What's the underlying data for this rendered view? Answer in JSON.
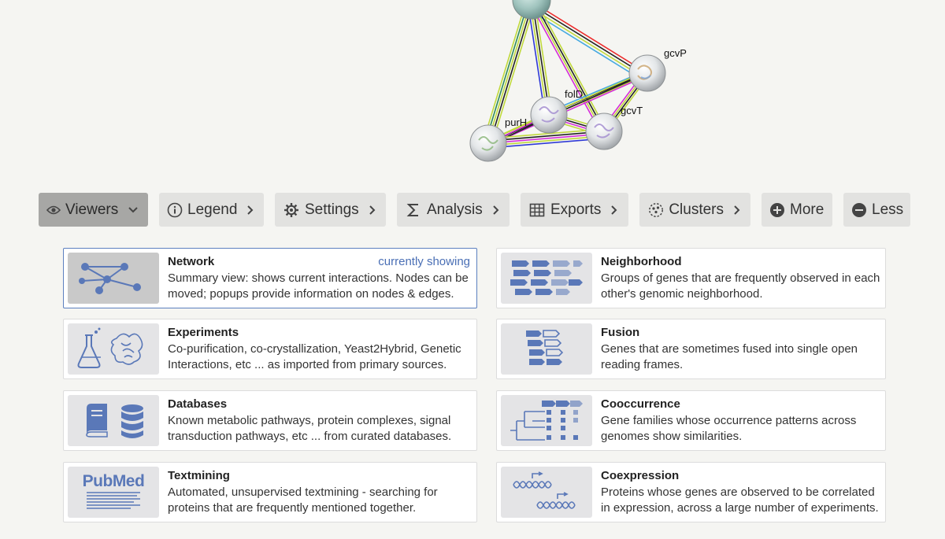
{
  "network": {
    "nodes": [
      {
        "label": "gcvP"
      },
      {
        "label": "folD"
      },
      {
        "label": "gcvT"
      },
      {
        "label": "purH"
      }
    ]
  },
  "toolbar": {
    "viewers": "Viewers",
    "legend": "Legend",
    "settings": "Settings",
    "analysis": "Analysis",
    "exports": "Exports",
    "clusters": "Clusters",
    "more": "More",
    "less": "Less"
  },
  "viewers": {
    "current_label": "currently showing",
    "network": {
      "title": "Network",
      "desc": "Summary view: shows current interactions. Nodes can be moved; popups provide information on nodes & edges."
    },
    "neighborhood": {
      "title": "Neighborhood",
      "desc": "Groups of genes that are frequently observed in each other's genomic neighborhood."
    },
    "experiments": {
      "title": "Experiments",
      "desc": "Co-purification, co-crystallization, Yeast2Hybrid, Genetic Interactions, etc ... as imported from primary sources."
    },
    "fusion": {
      "title": "Fusion",
      "desc": "Genes that are sometimes fused into single open reading frames."
    },
    "databases": {
      "title": "Databases",
      "desc": "Known metabolic pathways, protein complexes, signal transduction pathways, etc ... from curated databases."
    },
    "cooccurrence": {
      "title": "Cooccurrence",
      "desc": "Gene families whose occurrence patterns across genomes show similarities."
    },
    "textmining": {
      "title": "Textmining",
      "desc": "Automated, unsupervised textmining - searching for proteins that are frequently mentioned together.",
      "logo_text": "PubMed"
    },
    "coexpression": {
      "title": "Coexpression",
      "desc": "Proteins whose genes are observed to be correlated in expression, across a large number of experiments."
    }
  },
  "colors": {
    "accent": "#4a6fb5",
    "icon_blue": "#5a78b8",
    "toolbar_bg": "#e2e2e0",
    "toolbar_active": "#a7a7a5"
  }
}
